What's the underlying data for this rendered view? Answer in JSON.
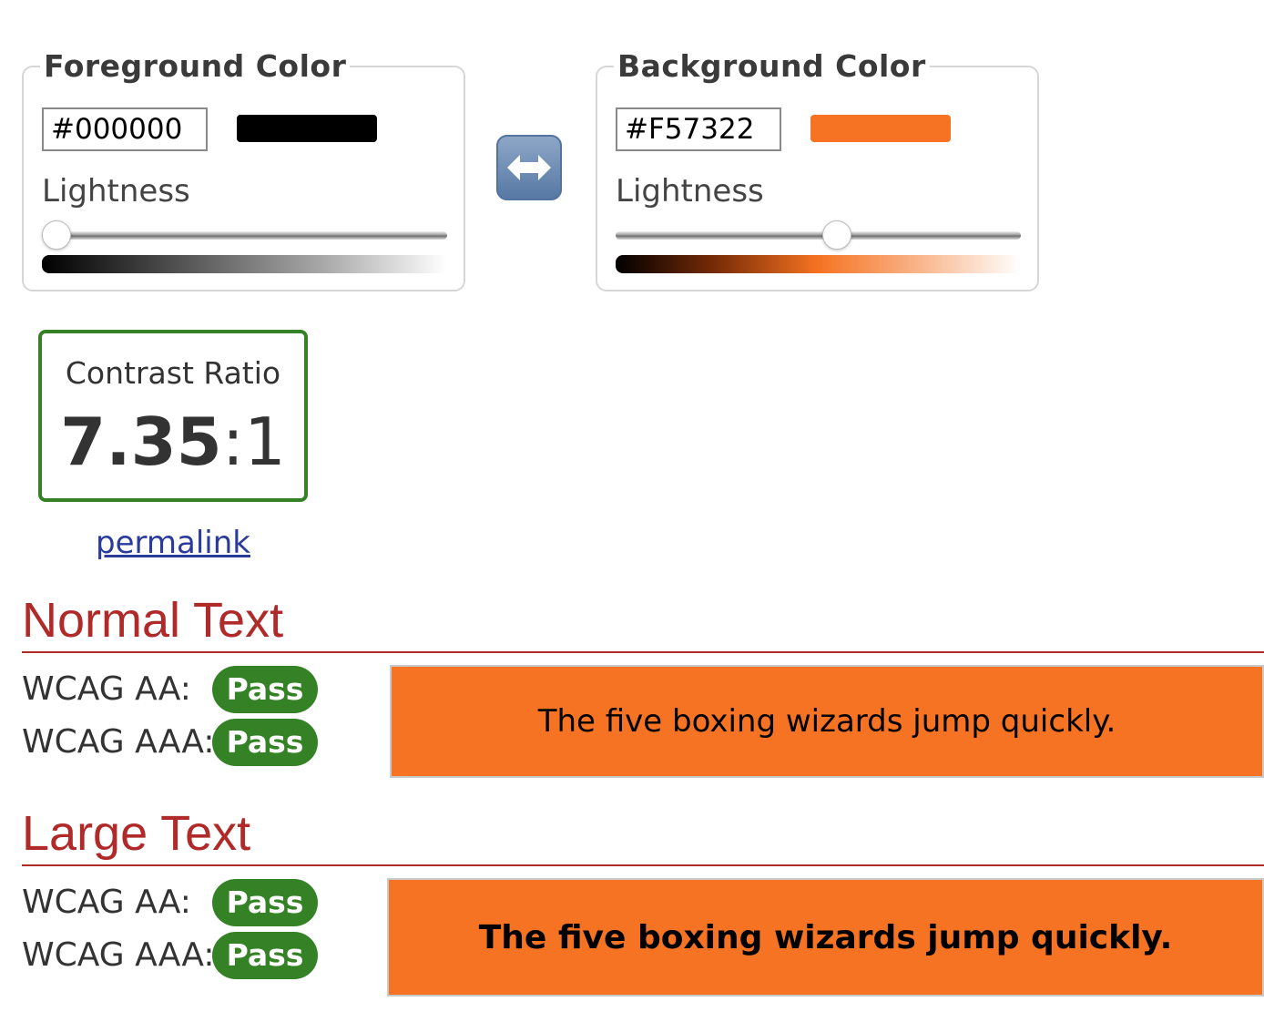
{
  "foreground": {
    "legend": "Foreground Color",
    "hex": "#000000",
    "swatch_color": "#000000",
    "lightness_label": "Lightness",
    "lightness_percent": 0
  },
  "background": {
    "legend": "Background Color",
    "hex": "#F57322",
    "swatch_color": "#F57322",
    "lightness_label": "Lightness",
    "lightness_percent": 55
  },
  "swap_icon": "left-right-arrow-icon",
  "contrast": {
    "label": "Contrast Ratio",
    "ratio_main": "7.35",
    "ratio_suffix": ":1",
    "border_color": "#358126"
  },
  "permalink": "permalink",
  "normal_text": {
    "title": "Normal Text",
    "aa_label": "WCAG AA:",
    "aa_result": "Pass",
    "aaa_label": "WCAG AAA:",
    "aaa_result": "Pass",
    "sample": "The five boxing wizards jump quickly."
  },
  "large_text": {
    "title": "Large Text",
    "aa_label": "WCAG AA:",
    "aa_result": "Pass",
    "aaa_label": "WCAG AAA:",
    "aaa_result": "Pass",
    "sample": "The five boxing wizards jump quickly."
  },
  "colors": {
    "pass_green": "#358126",
    "heading_red": "#B02A2A",
    "link_blue": "#2A3B9C"
  }
}
